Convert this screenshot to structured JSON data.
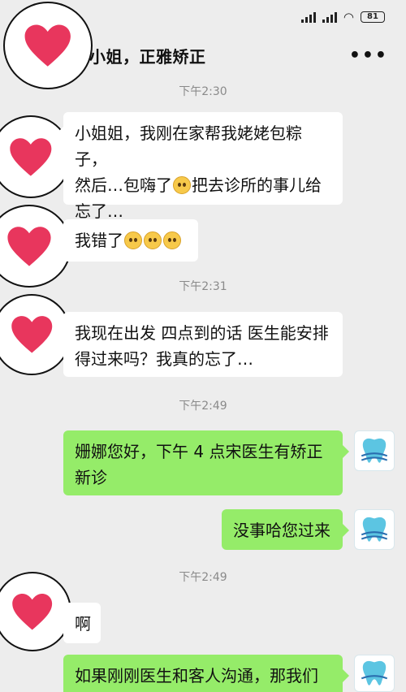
{
  "status_bar": {
    "battery": "81",
    "wifi_icon": "wifi-icon",
    "signal_icon": "signal-icon"
  },
  "header": {
    "title": "小姐，正雅矫正",
    "more_icon": "more-dots-icon"
  },
  "timestamps": [
    "下午2:30",
    "下午2:31",
    "下午2:49",
    "下午2:49"
  ],
  "messages": [
    {
      "side": "in",
      "lines": [
        "小姐姐，我刚在家帮我姥姥包粽子，",
        "然后…包嗨了",
        "把去诊所的事儿给",
        "忘了…"
      ]
    },
    {
      "side": "in",
      "text": "我错了"
    },
    {
      "side": "in",
      "lines": [
        "我现在出发 四点到的话 医生能安排",
        "得过来吗？我真的忘了…"
      ]
    },
    {
      "side": "out",
      "lines": [
        "姗娜您好，下午 4 点宋医生有矫正",
        "新诊"
      ]
    },
    {
      "side": "out",
      "text": "没事哈您过来"
    },
    {
      "side": "in",
      "text": "啊"
    },
    {
      "side": "out",
      "text": "如果刚刚医生和客人沟通，那我们"
    }
  ],
  "avatars": {
    "customer": "heart-icon",
    "clinic": "tooth-icon"
  },
  "colors": {
    "outgoing_bubble": "#95ec69",
    "incoming_bubble": "#ffffff",
    "background": "#ededed",
    "heart": "#e8365d"
  }
}
